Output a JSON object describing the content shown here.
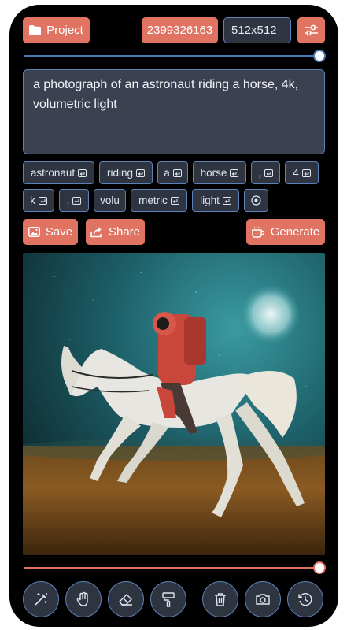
{
  "header": {
    "project_label": "Project",
    "seed": "2399326163",
    "size": "512x512"
  },
  "strength_slider": {
    "value": 1.0
  },
  "prompt": {
    "text": "a photograph of an astronaut riding a horse, 4k, volumetric light"
  },
  "tokens": [
    {
      "label": "astronaut"
    },
    {
      "label": "riding"
    },
    {
      "label": "a"
    },
    {
      "label": "horse"
    },
    {
      "label": ","
    },
    {
      "label": "4"
    },
    {
      "label": "k"
    },
    {
      "label": ","
    },
    {
      "label": "volu"
    },
    {
      "label": "metric"
    },
    {
      "label": "light"
    }
  ],
  "actions": {
    "save_label": "Save",
    "share_label": "Share",
    "generate_label": "Generate"
  },
  "image_slider": {
    "value": 1.0
  },
  "toolbar": {
    "tools": [
      "magic-wand-icon",
      "hand-icon",
      "eraser-icon",
      "paint-roller-icon",
      "trash-icon",
      "camera-icon",
      "history-icon"
    ]
  },
  "colors": {
    "accent": "#e07361",
    "panel": "#2f3441",
    "border": "#5a81b8",
    "blue_track": "#4a7ab8"
  }
}
